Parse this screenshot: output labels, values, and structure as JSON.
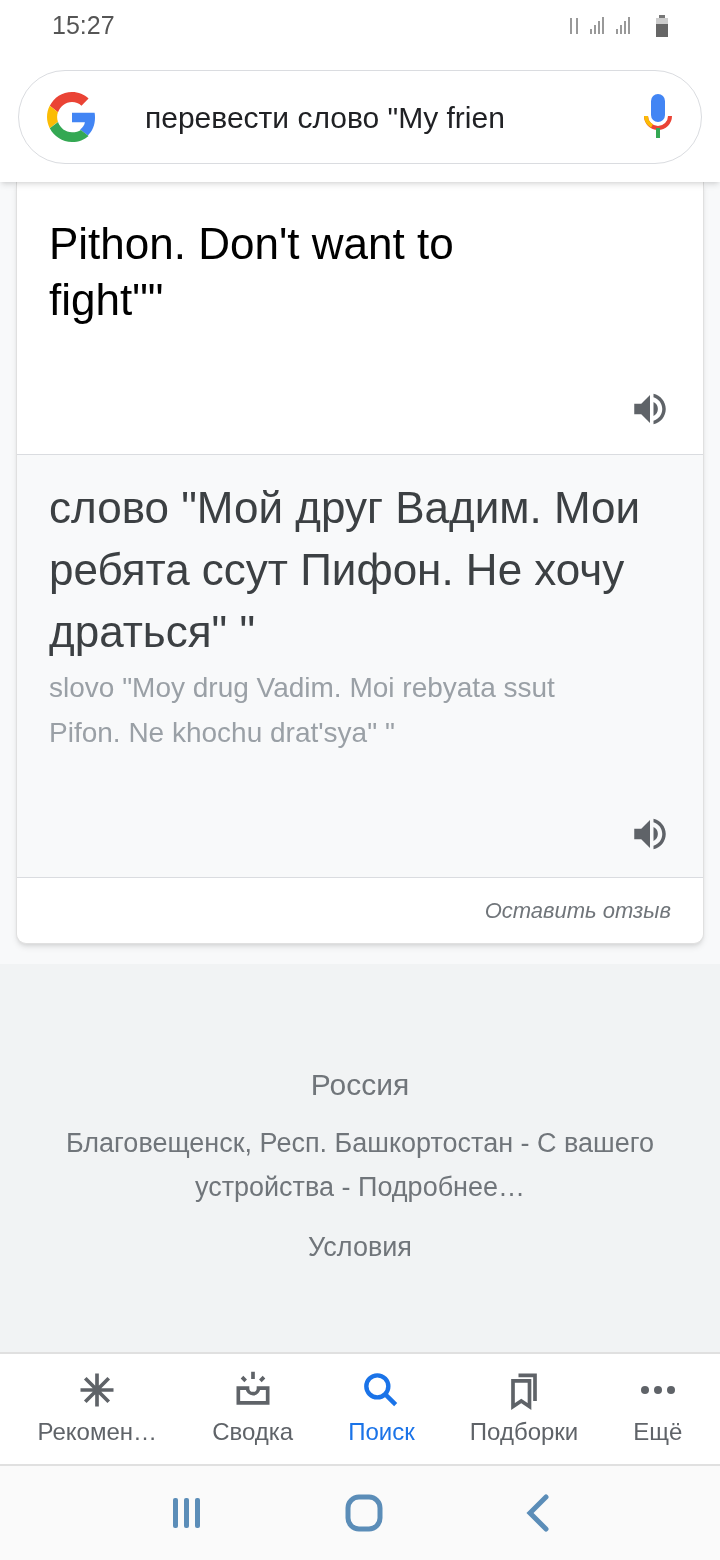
{
  "status_bar": {
    "time": "15:27"
  },
  "search": {
    "query": "перевести слово \"My frien"
  },
  "translation": {
    "source_text": "Pithon. Don't want to fight\"\"",
    "target_text": "слово \"Мой друг Вадим. Мои ребята ссут Пифон. Не хочу драться\" \"",
    "transliteration": "slovo \"Moy drug Vadim. Moi rebyata ssut Pifon. Ne khochu drat'sya\" \"",
    "feedback": "Оставить отзыв"
  },
  "footer": {
    "country": "Россия",
    "location": "Благовещенск, Респ. Башкортостан - С вашего устройства - Подробнее…",
    "terms": "Условия"
  },
  "bottom_nav": [
    {
      "kind": "recommend",
      "label": "Рекомен…",
      "selected": false
    },
    {
      "kind": "summary",
      "label": "Сводка",
      "selected": false
    },
    {
      "kind": "search",
      "label": "Поиск",
      "selected": true
    },
    {
      "kind": "collections",
      "label": "Подборки",
      "selected": false
    },
    {
      "kind": "more",
      "label": "Ещё",
      "selected": false
    }
  ]
}
